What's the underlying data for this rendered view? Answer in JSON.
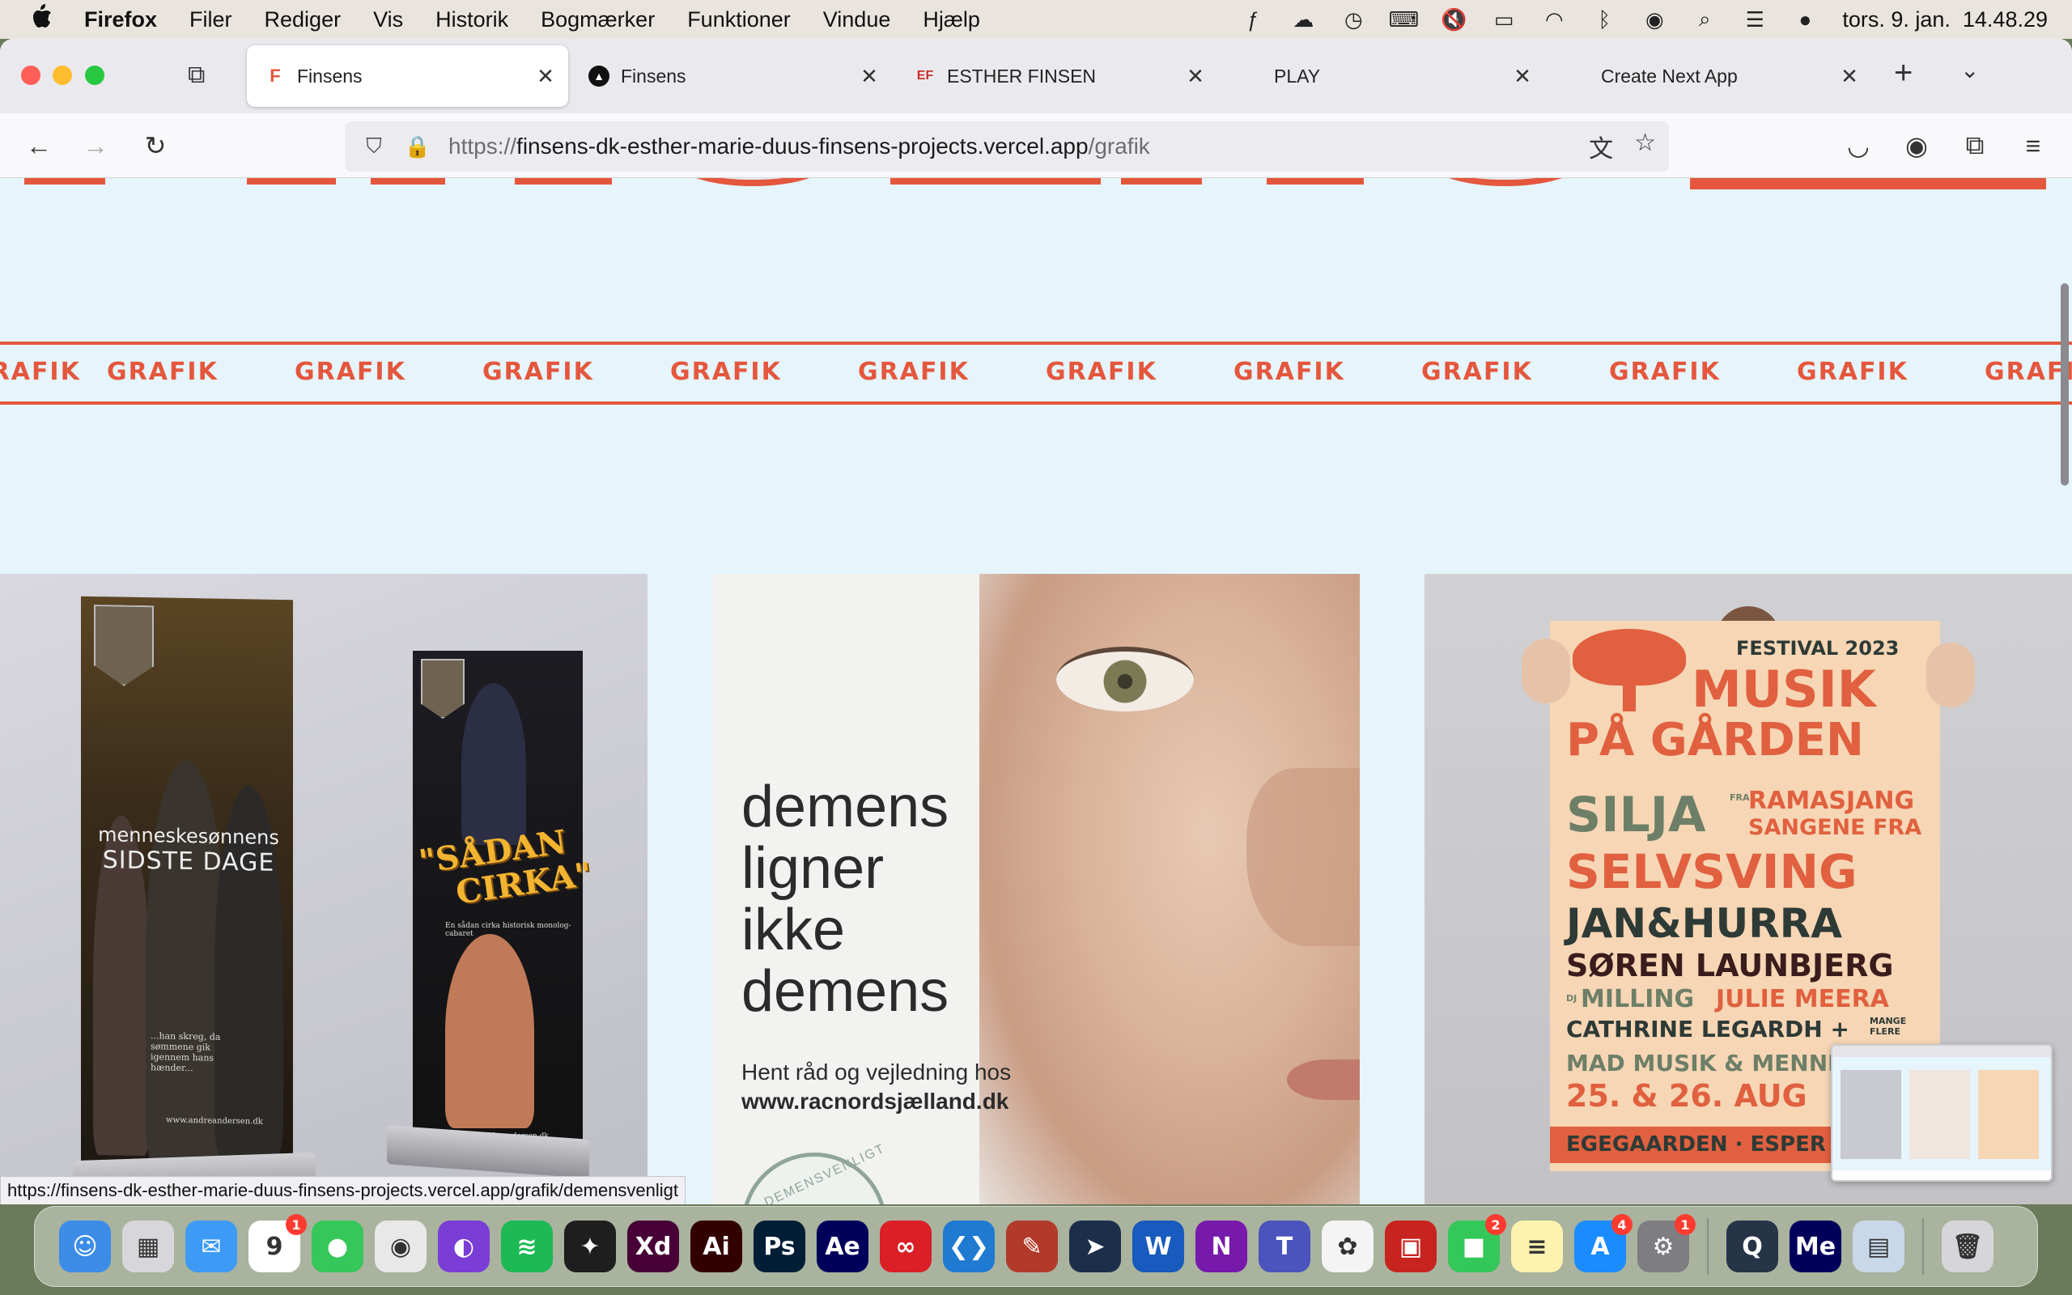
{
  "menubar": {
    "apple": "",
    "app_name": "Firefox",
    "items": [
      "Filer",
      "Rediger",
      "Vis",
      "Historik",
      "Bogmærker",
      "Funktioner",
      "Vindue",
      "Hjælp"
    ],
    "clock": "tors. 9. jan.  14.48.29"
  },
  "tabs": [
    {
      "title": "Finsens",
      "favicon": "F",
      "active": true
    },
    {
      "title": "Finsens",
      "favicon": "▲",
      "active": false
    },
    {
      "title": "ESTHER FINSEN",
      "favicon": "EF",
      "active": false
    },
    {
      "title": "PLAY",
      "favicon": "",
      "active": false
    },
    {
      "title": "Create Next App",
      "favicon": "",
      "active": false
    }
  ],
  "tab_close": "✕",
  "new_tab": "+",
  "tab_list": "⌄",
  "urlbar": {
    "prefix": "https://",
    "host": "finsens-dk-esther-marie-duus-finsens-projects.vercel.app",
    "path": "/grafik"
  },
  "page": {
    "marquee_word": "GRAFIK",
    "card1": {
      "banner1_line1": "menneskesønnens",
      "banner1_line2": "SIDSTE DAGE",
      "banner1_quote": "...han skreg, da sømmene gik igennem hans hænder...",
      "banner1_url": "www.andreandersen.dk",
      "banner2_title_1": "\"SÅDAN",
      "banner2_title_2": "CIRKA\"",
      "banner2_sub": "En sådan cirka historisk monolog-cabaret",
      "banner2_url": "www.andreandersen.dk"
    },
    "card2": {
      "headline": [
        "demens",
        "ligner",
        "ikke",
        "demens"
      ],
      "sub1": "Hent råd og vejledning hos",
      "sub2": "www.racnordsjælland.dk",
      "badge": "DEMENSVENLIGT"
    },
    "card3": {
      "festival": "FESTIVAL 2023",
      "musik": "MUSIK",
      "paagarden": "PÅ GÅRDEN",
      "silja": "SILJA",
      "fra": "FRA",
      "ramasjang": "RAMASJANG",
      "sangene": "SANGENE FRA",
      "selvsving": "SELVSVING",
      "jan": "JAN&HURRA",
      "soren": "SØREN LAUNBJERG",
      "dj": "DJ",
      "milling": "MILLING",
      "julie": "JULIE MEERA",
      "cathrine": "CATHRINE LEGARDH +",
      "mange": "MANGE FLERE",
      "mad": "MAD MUSIK & MENNESKER",
      "dato": "25. & 26. AUG",
      "ege": "EGEGAARDEN · ESPER"
    },
    "status_link": "https://finsens-dk-esther-marie-duus-finsens-projects.vercel.app/grafik/demensvenligt"
  },
  "colors": {
    "accent": "#e4573d",
    "page_bg": "#e6f4fb"
  },
  "dock": [
    {
      "name": "finder",
      "label": "☺",
      "bg": "#3c8ce8"
    },
    {
      "name": "launchpad",
      "label": "▦",
      "bg": "#d7d7db"
    },
    {
      "name": "mail",
      "label": "✉",
      "bg": "#3d9af5"
    },
    {
      "name": "calendar",
      "label": "9",
      "bg": "#ffffff",
      "badge": "1"
    },
    {
      "name": "messages",
      "label": "●",
      "bg": "#35c759"
    },
    {
      "name": "chrome",
      "label": "◉",
      "bg": "#e8e8e8"
    },
    {
      "name": "firefox",
      "label": "◐",
      "bg": "#7a3dd6"
    },
    {
      "name": "spotify",
      "label": "≋",
      "bg": "#1db954"
    },
    {
      "name": "figma",
      "label": "✦",
      "bg": "#1e1e1e"
    },
    {
      "name": "xd",
      "label": "Xd",
      "bg": "#470137"
    },
    {
      "name": "illustrator",
      "label": "Ai",
      "bg": "#330000"
    },
    {
      "name": "photoshop",
      "label": "Ps",
      "bg": "#001e36"
    },
    {
      "name": "after-effects",
      "label": "Ae",
      "bg": "#00005b"
    },
    {
      "name": "creative-cloud",
      "label": "∞",
      "bg": "#da1f26"
    },
    {
      "name": "vscode",
      "label": "❮❯",
      "bg": "#1f7ad1"
    },
    {
      "name": "safari-tech",
      "label": "✎",
      "bg": "#b23a2a"
    },
    {
      "name": "telegram",
      "label": "➤",
      "bg": "#1c2e4a"
    },
    {
      "name": "word",
      "label": "W",
      "bg": "#185abd"
    },
    {
      "name": "onenote",
      "label": "N",
      "bg": "#7719aa"
    },
    {
      "name": "teams",
      "label": "T",
      "bg": "#4b53bc"
    },
    {
      "name": "photos",
      "label": "✿",
      "bg": "#f4f4f4"
    },
    {
      "name": "photo-booth",
      "label": "▣",
      "bg": "#c8241f"
    },
    {
      "name": "facetime",
      "label": "■",
      "bg": "#34c759",
      "badge": "2"
    },
    {
      "name": "notes",
      "label": "≡",
      "bg": "#fdf2b0"
    },
    {
      "name": "app-store",
      "label": "A",
      "bg": "#1a8cff",
      "badge": "4"
    },
    {
      "name": "system-settings",
      "label": "⚙",
      "bg": "#7d7d82",
      "badge": "1"
    },
    {
      "name": "quicktime",
      "label": "Q",
      "bg": "#263448"
    },
    {
      "name": "media-encoder",
      "label": "Me",
      "bg": "#00005b"
    },
    {
      "name": "preview",
      "label": "▤",
      "bg": "#c9d8e8"
    },
    {
      "name": "trash",
      "label": "🗑",
      "bg": "#d6d6da"
    }
  ]
}
